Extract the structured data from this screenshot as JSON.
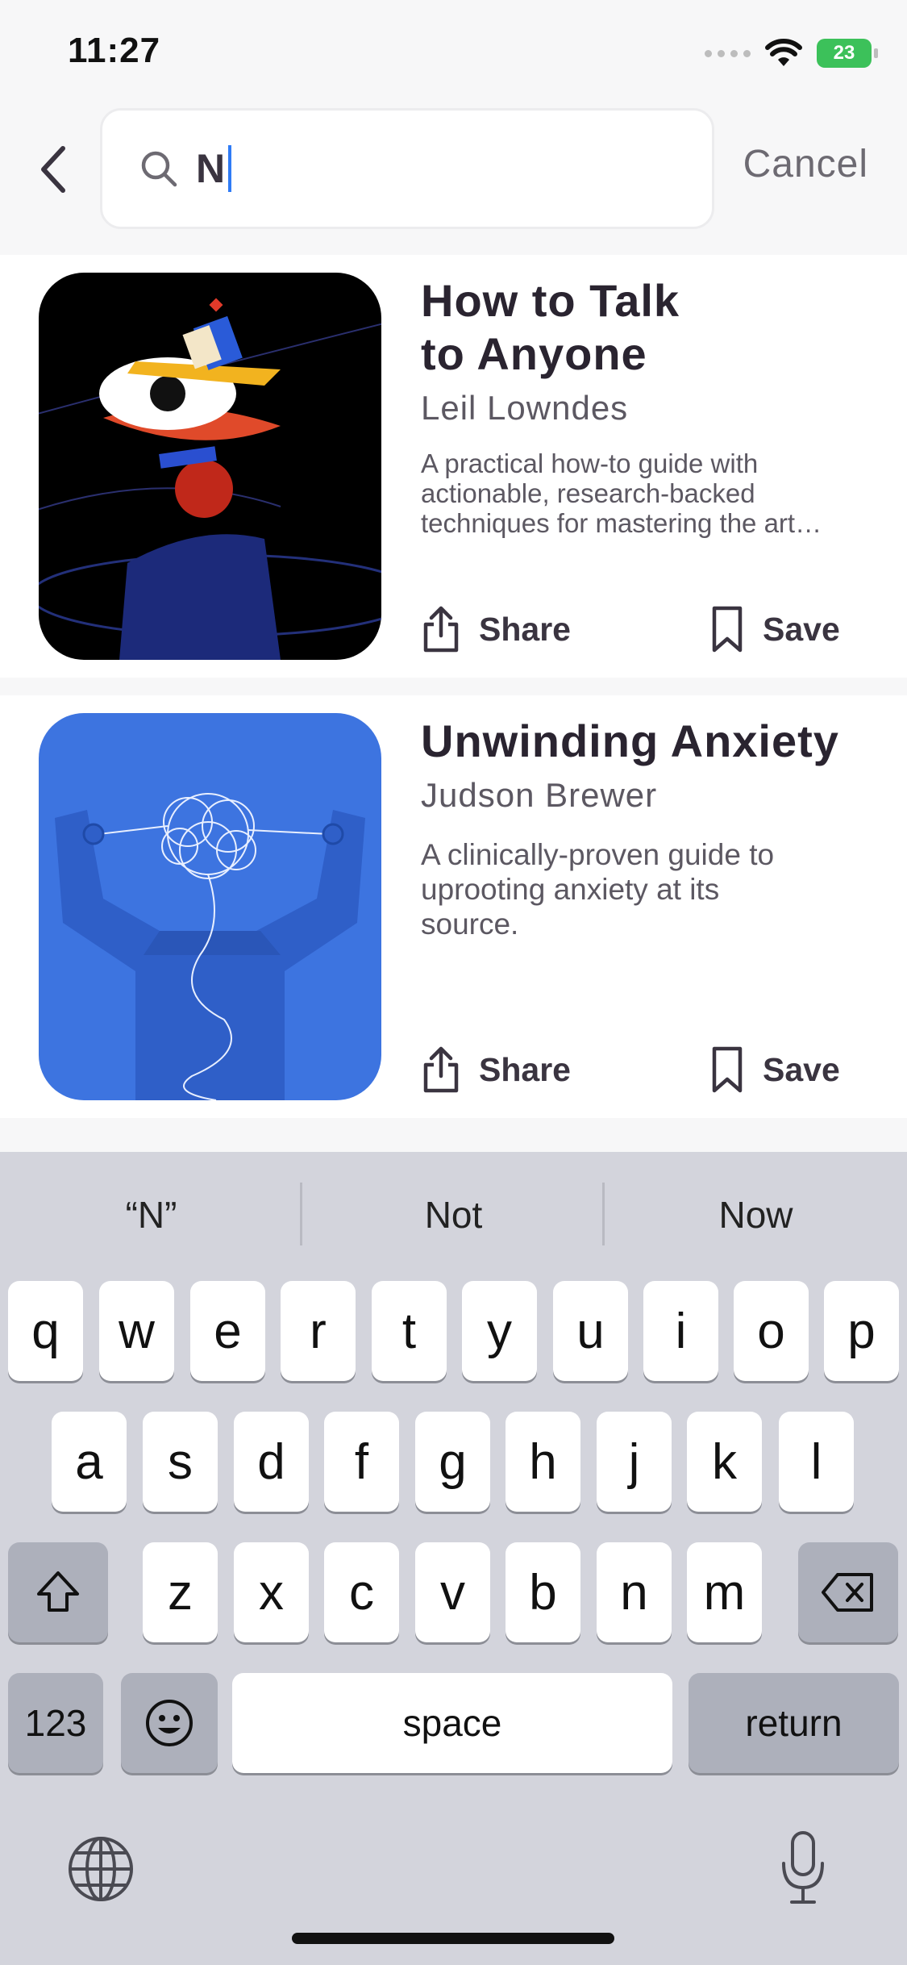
{
  "status_bar": {
    "time": "11:27",
    "battery": "23"
  },
  "search": {
    "query": "N",
    "cancel_label": "Cancel"
  },
  "results": [
    {
      "title_line1": "How to Talk",
      "title_line2": "to Anyone",
      "author": "Leil Lowndes",
      "desc_line1": "A practical how-to guide with",
      "desc_line2": "actionable, research-backed",
      "desc_line3": "techniques for mastering the art…",
      "share_label": "Share",
      "save_label": "Save"
    },
    {
      "title_line1": "Unwinding Anxiety",
      "author": "Judson Brewer",
      "desc_line1": "A clinically-proven guide to",
      "desc_line2": "uprooting anxiety at its",
      "desc_line3": "source.",
      "share_label": "Share",
      "save_label": "Save"
    }
  ],
  "keyboard": {
    "suggestions": [
      "“N”",
      "Not",
      "Now"
    ],
    "row1": [
      "q",
      "w",
      "e",
      "r",
      "t",
      "y",
      "u",
      "i",
      "o",
      "p"
    ],
    "row2": [
      "a",
      "s",
      "d",
      "f",
      "g",
      "h",
      "j",
      "k",
      "l"
    ],
    "row3": [
      "z",
      "x",
      "c",
      "v",
      "b",
      "n",
      "m"
    ],
    "numbers_label": "123",
    "space_label": "space",
    "return_label": "return"
  },
  "colors": {
    "accent_caret": "#2f7cf6",
    "battery": "#3cc15a",
    "cover1_bg": "#000000",
    "cover2_bg": "#3d74e0"
  }
}
